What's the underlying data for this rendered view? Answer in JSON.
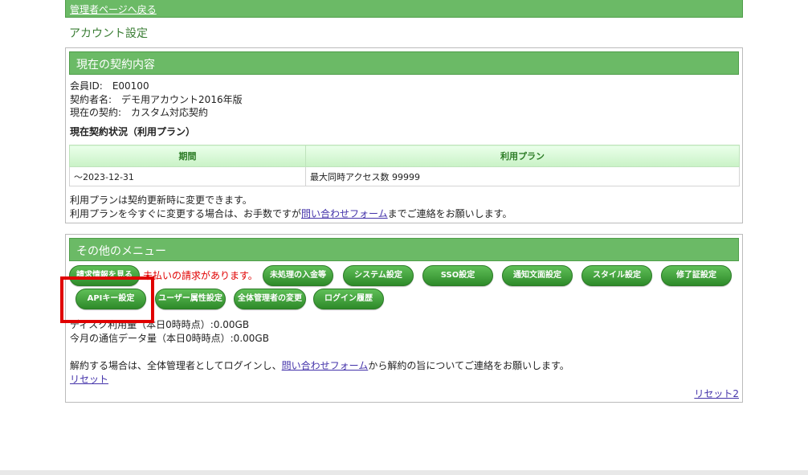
{
  "topbar": {
    "back_link": "管理者ページへ戻る"
  },
  "page_title": "アカウント設定",
  "contract": {
    "heading": "現在の契約内容",
    "member_id": "会員ID:　E00100",
    "contractor": "契約者名:　デモ用アカウント2016年版",
    "current_contract": "現在の契約:　カスタム対応契約",
    "status_title": "現在契約状況（利用プラン）",
    "table": {
      "headers": [
        "期間",
        "利用プラン"
      ],
      "rows": [
        [
          "～2023-12-31",
          "最大同時アクセス数 99999"
        ]
      ]
    },
    "note1": "利用プランは契約更新時に変更できます。",
    "note2_prefix": "利用プランを今すぐに変更する場合は、お手数ですが",
    "note2_link": "問い合わせフォーム",
    "note2_suffix": "までご連絡をお願いします。"
  },
  "other_menu": {
    "heading": "その他のメニュー",
    "buttons": {
      "billing": "請求情報を見る",
      "unpaid_alert": "未払いの請求があります。",
      "unprocessed_payments": "未処理の入金等",
      "system_settings": "システム設定",
      "sso_settings": "SSO設定",
      "notification_text": "通知文面設定",
      "style_settings": "スタイル設定",
      "certificate_settings": "修了証設定",
      "api_key": "APIキー設定",
      "user_attributes": "ユーザー属性設定",
      "admin_change": "全体管理者の変更",
      "login_history": "ログイン履歴"
    },
    "disk_usage": "ディスク利用量（本日0時時点）:0.00GB",
    "data_usage": "今月の通信データ量（本日0時時点）:0.00GB",
    "cancel_prefix": "解約する場合は、全体管理者としてログインし、",
    "cancel_link": "問い合わせフォーム",
    "cancel_suffix": "から解約の旨についてご連絡をお願いします。",
    "reset_link": "リセット",
    "reset2_link": "リセット2"
  },
  "colors": {
    "header_green": "#6bba66",
    "button_green": "#2e8a29",
    "alert_red": "#e00000"
  }
}
